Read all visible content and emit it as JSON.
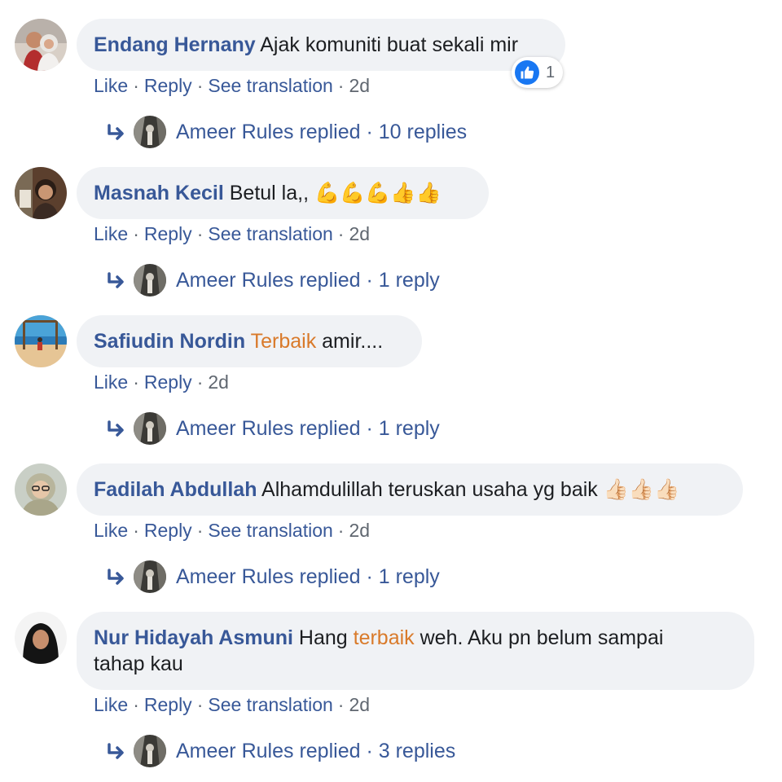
{
  "comments": [
    {
      "author": "Endang Hernany",
      "text_parts": [
        "Ajak komuniti buat sekali mir"
      ],
      "actions": {
        "like": "Like",
        "reply": "Reply",
        "translate": "See translation",
        "time": "2d"
      },
      "reaction": {
        "icon": "like-icon",
        "count": "1"
      },
      "replies": {
        "name": "Ameer Rules",
        "verb": "replied",
        "count": "10 replies"
      }
    },
    {
      "author": "Masnah Kecil",
      "text": "Betul la,,",
      "emoji": "💪💪💪👍👍",
      "actions": {
        "like": "Like",
        "reply": "Reply",
        "translate": "See translation",
        "time": "2d"
      },
      "replies": {
        "name": "Ameer Rules",
        "verb": "replied",
        "count": "1 reply"
      }
    },
    {
      "author": "Safiudin Nordin",
      "highlight": "Terbaik",
      "text": "amir....",
      "actions": {
        "like": "Like",
        "reply": "Reply",
        "time": "2d"
      },
      "replies": {
        "name": "Ameer Rules",
        "verb": "replied",
        "count": "1 reply"
      }
    },
    {
      "author": "Fadilah Abdullah",
      "text": "Alhamdulillah teruskan usaha yg baik",
      "emoji": "👍🏻👍🏻👍🏻",
      "actions": {
        "like": "Like",
        "reply": "Reply",
        "translate": "See translation",
        "time": "2d"
      },
      "replies": {
        "name": "Ameer Rules",
        "verb": "replied",
        "count": "1 reply"
      }
    },
    {
      "author": "Nur Hidayah Asmuni",
      "text_before": "Hang",
      "highlight": "terbaik",
      "text_after": "weh. Aku pn belum sampai",
      "text_line2": "tahap kau",
      "actions": {
        "like": "Like",
        "reply": "Reply",
        "translate": "See translation",
        "time": "2d"
      },
      "replies": {
        "name": "Ameer Rules",
        "verb": "replied",
        "count": "3 replies"
      }
    }
  ],
  "separator": "·",
  "colors": {
    "author": "#385898",
    "highlight": "#d97a2a",
    "bubble": "#f0f2f5",
    "meta": "#606770",
    "like_blue": "#1877f2"
  }
}
